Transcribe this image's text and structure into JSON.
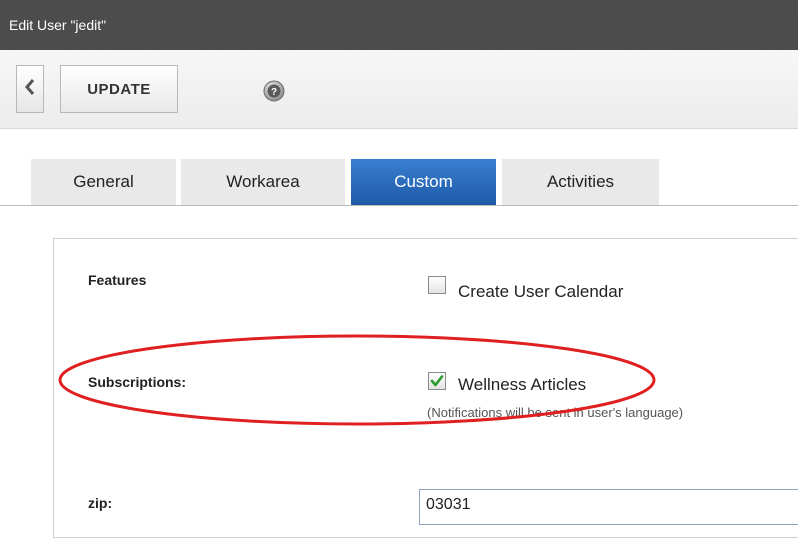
{
  "window": {
    "title": "Edit User \"jedit\""
  },
  "toolbar": {
    "back_icon": "chevron-left-icon",
    "update_label": "UPDATE",
    "help_icon": "help-icon"
  },
  "tabs": [
    {
      "label": "General",
      "active": false
    },
    {
      "label": "Workarea",
      "active": false
    },
    {
      "label": "Custom",
      "active": true
    },
    {
      "label": "Activities",
      "active": false
    }
  ],
  "form": {
    "features": {
      "label": "Features",
      "option_label": "Create User Calendar",
      "checked": false
    },
    "subscriptions": {
      "label": "Subscriptions:",
      "option_label": "Wellness Articles",
      "checked": true,
      "note": "(Notifications will be sent in user's language)"
    },
    "zip": {
      "label": "zip:",
      "value": "03031"
    }
  },
  "colors": {
    "title_bar": "#4a4a4a",
    "active_tab": "#2a6bbd",
    "check_mark": "#2a9a2a",
    "annotation": "#e02020"
  }
}
